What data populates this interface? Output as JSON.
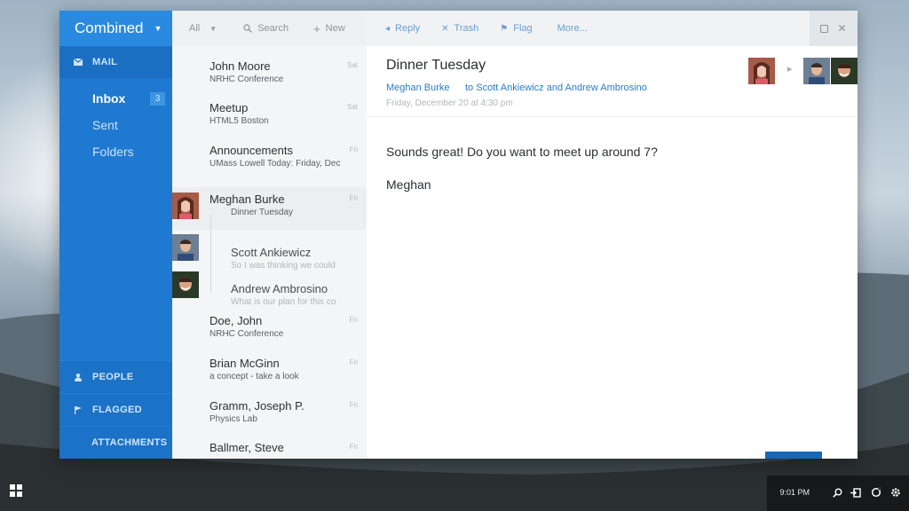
{
  "nav": {
    "account": "Combined",
    "mail_section": "MAIL",
    "items": [
      {
        "label": "Inbox",
        "badge": "3"
      },
      {
        "label": "Sent"
      },
      {
        "label": "Folders"
      }
    ],
    "bottom": [
      {
        "label": "PEOPLE",
        "icon": "person-icon"
      },
      {
        "label": "FLAGGED",
        "icon": "flag-icon"
      },
      {
        "label": "ATTACHMENTS",
        "icon": ""
      }
    ]
  },
  "list_toolbar": {
    "filter": "All",
    "search": "Search",
    "new": "New"
  },
  "messages": [
    {
      "from": "John Moore",
      "subject": "NRHC Conference",
      "day": "Sat"
    },
    {
      "from": "Meetup",
      "subject": "HTML5 Boston",
      "day": "Sat"
    },
    {
      "from": "Announcements",
      "subject": "UMass Lowell Today: Friday, Dec",
      "day": "Fri"
    },
    {
      "from": "Meghan Burke",
      "subject": "Dinner Tuesday",
      "day": "Fri"
    },
    {
      "from": "Scott Ankiewicz",
      "subject": "So I was thinking we could",
      "day": ""
    },
    {
      "from": "Andrew Ambrosino",
      "subject": "What is our plan for this co",
      "day": ""
    },
    {
      "from": "Doe, John",
      "subject": "NRHC Conference",
      "day": "Fri"
    },
    {
      "from": "Brian McGinn",
      "subject": "a concept - take a look",
      "day": "Fri"
    },
    {
      "from": "Gramm, Joseph P.",
      "subject": "Physics Lab",
      "day": "Fri"
    },
    {
      "from": "Ballmer, Steve",
      "subject": "",
      "day": "Fri"
    }
  ],
  "pane_toolbar": {
    "reply": "Reply",
    "trash": "Trash",
    "flag": "Flag",
    "more": "More..."
  },
  "email": {
    "subject": "Dinner Tuesday",
    "from": "Meghan Burke",
    "to": "to Scott Ankiewicz and Andrew Ambrosino",
    "date": "Friday, December 20 at 4:30 pm",
    "body_line1": "Sounds great! Do you want to meet up around 7?",
    "body_line2": "Meghan"
  },
  "taskbar": {
    "time": "9:01 PM"
  },
  "colors": {
    "accent": "#1f79d1",
    "accent_light": "#2a8ae0",
    "link": "#2b7dc9"
  }
}
